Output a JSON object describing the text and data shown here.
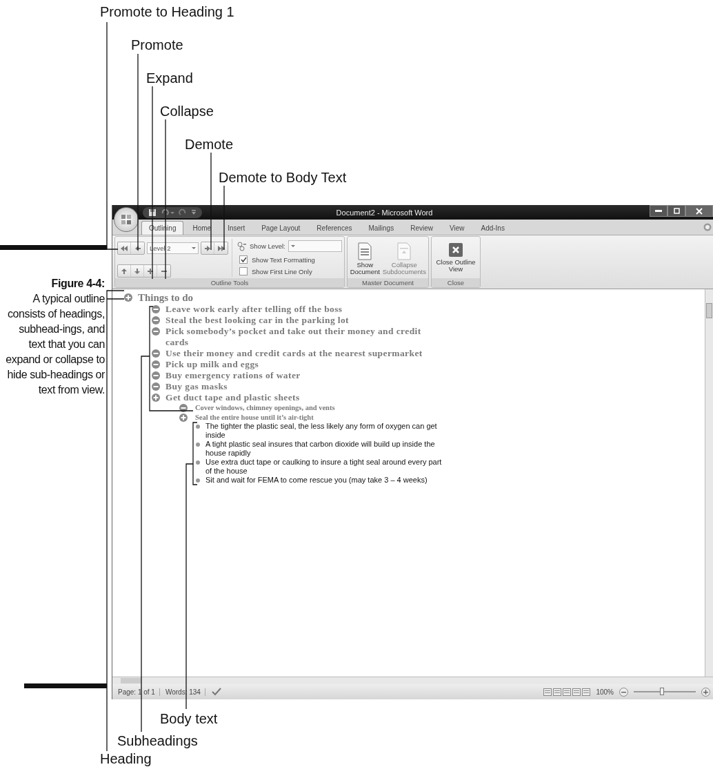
{
  "callouts_top": [
    {
      "label": "Promote to Heading 1"
    },
    {
      "label": "Promote"
    },
    {
      "label": "Expand"
    },
    {
      "label": "Collapse"
    },
    {
      "label": "Demote"
    },
    {
      "label": "Demote to Body Text"
    }
  ],
  "figure_caption": {
    "number": "Figure 4-4:",
    "text": "A typical outline consists of headings, subhead-ings, and text that you can expand or collapse to hide sub-headings or text from view."
  },
  "window": {
    "title": "Document2 - Microsoft Word"
  },
  "tabs": [
    {
      "label": "Outlining",
      "selected": true
    },
    {
      "label": "Home",
      "selected": false
    },
    {
      "label": "Insert",
      "selected": false
    },
    {
      "label": "Page Layout",
      "selected": false
    },
    {
      "label": "References",
      "selected": false
    },
    {
      "label": "Mailings",
      "selected": false
    },
    {
      "label": "Review",
      "selected": false
    },
    {
      "label": "View",
      "selected": false
    },
    {
      "label": "Add-Ins",
      "selected": false
    }
  ],
  "ribbon": {
    "outline_tools": {
      "level_dropdown": "Level 2",
      "show_level_label": "Show Level:",
      "checkboxes": [
        {
          "label": "Show Text Formatting",
          "checked": true
        },
        {
          "label": "Show First Line Only",
          "checked": false
        }
      ],
      "group_label": "Outline Tools"
    },
    "master_document": {
      "buttons": [
        {
          "label": "Show Document",
          "disabled": false
        },
        {
          "label": "Collapse Subdocuments",
          "disabled": true
        }
      ],
      "group_label": "Master Document"
    },
    "close": {
      "button": "Close Outline View",
      "group_label": "Close"
    }
  },
  "outline": [
    {
      "text": "Things to do",
      "kind": "heading",
      "children": [
        {
          "text": "Leave work early after telling off the boss",
          "kind": "heading"
        },
        {
          "text": "Steal the best looking car in the parking lot",
          "kind": "heading"
        },
        {
          "text": "Pick somebody’s pocket and take out their money and credit cards",
          "kind": "heading"
        },
        {
          "text": "Use their money and credit cards at the nearest supermarket",
          "kind": "heading"
        },
        {
          "text": "Pick up milk and eggs",
          "kind": "heading"
        },
        {
          "text": "Buy emergency rations of water",
          "kind": "heading"
        },
        {
          "text": "Buy gas masks",
          "kind": "heading"
        },
        {
          "text": "Get duct tape and plastic sheets",
          "kind": "heading",
          "children": [
            {
              "text": "Cover windows, chimney openings, and vents",
              "kind": "heading"
            },
            {
              "text": "Seal the entire house until it’s air-tight",
              "kind": "heading",
              "children": [
                {
                  "text": "The tighter the plastic seal, the less likely any form of oxygen can get inside",
                  "kind": "body"
                },
                {
                  "text": "A tight plastic seal insures that carbon dioxide will build up inside the house rapidly",
                  "kind": "body"
                },
                {
                  "text": "Use extra duct tape or caulking to insure a tight seal around every part of the house",
                  "kind": "body"
                },
                {
                  "text": "Sit and wait for FEMA to come rescue you (may take 3 – 4 weeks)",
                  "kind": "body"
                }
              ]
            }
          ]
        }
      ]
    }
  ],
  "status_bar": {
    "page": "Page: 1 of 1",
    "words": "Words: 134",
    "zoom": "100%",
    "zoom_slider": {
      "level": 0.45
    }
  },
  "callouts_bottom": [
    {
      "label": "Body text"
    },
    {
      "label": "Subheadings"
    },
    {
      "label": "Heading"
    }
  ]
}
